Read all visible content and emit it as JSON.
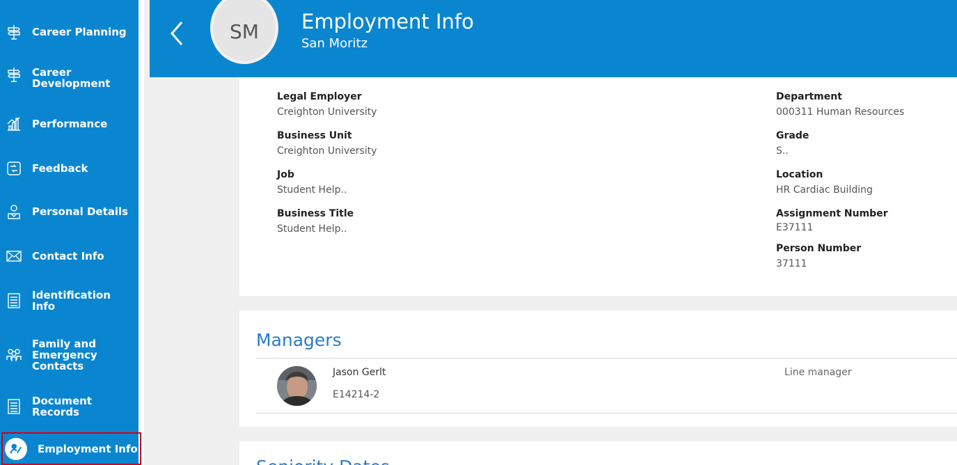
{
  "sidebar": {
    "items": [
      {
        "label": "Career Planning",
        "icon": "signpost-icon"
      },
      {
        "label": "Career Development",
        "icon": "signpost-icon"
      },
      {
        "label": "Performance",
        "icon": "bar-chart-icon"
      },
      {
        "label": "Feedback",
        "icon": "feedback-icon"
      },
      {
        "label": "Personal Details",
        "icon": "person-icon"
      },
      {
        "label": "Contact Info",
        "icon": "envelope-icon"
      },
      {
        "label": "Identification Info",
        "icon": "document-icon"
      },
      {
        "label": "Family and Emergency Contacts",
        "icon": "people-icon"
      },
      {
        "label": "Document Records",
        "icon": "document-icon"
      },
      {
        "label": "Employment Info",
        "icon": "employment-icon",
        "active": true
      }
    ]
  },
  "header": {
    "avatar_initials": "SM",
    "title": "Employment Info",
    "subtitle": "San Moritz"
  },
  "employment": {
    "left": [
      {
        "label": "Legal Employer",
        "value": "Creighton University"
      },
      {
        "label": "Business Unit",
        "value": "Creighton University"
      },
      {
        "label": "Job",
        "value": "Student Help.."
      },
      {
        "label": "Business Title",
        "value": "Student Help.."
      }
    ],
    "right": [
      {
        "label": "Department",
        "value": "000311 Human Resources"
      },
      {
        "label": "Grade",
        "value": "S.."
      },
      {
        "label": "Location",
        "value": "HR Cardiac Building"
      },
      {
        "label": "Assignment Number",
        "value": "E37111"
      },
      {
        "label": "Person Number",
        "value": "37111"
      }
    ]
  },
  "managers": {
    "title": "Managers",
    "items": [
      {
        "name": "Jason Gerlt",
        "id": "E14214-2",
        "role": "Line manager"
      }
    ]
  },
  "seniority": {
    "title": "Seniority Dates"
  },
  "colors": {
    "brand": "#0a86d1",
    "section_title": "#2b7bc4",
    "active_outline": "#d0021b"
  }
}
